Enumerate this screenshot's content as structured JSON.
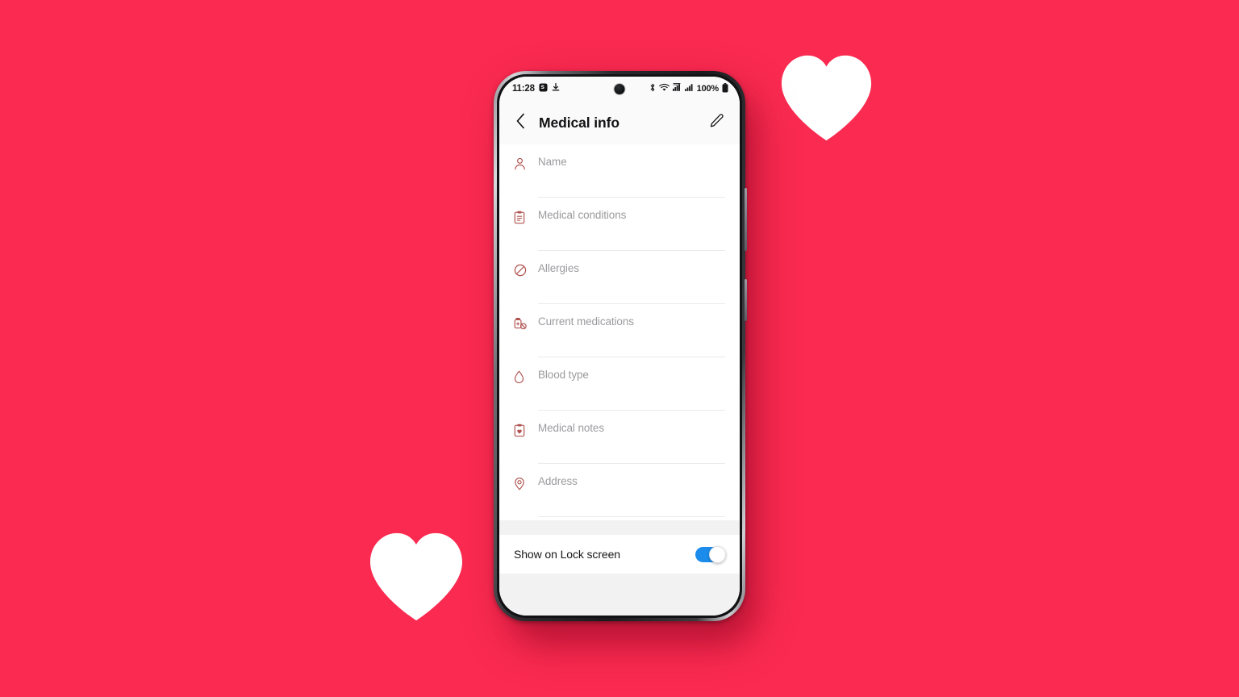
{
  "background": {
    "color": "#fa2a50",
    "decorations": [
      {
        "name": "heart-top-right",
        "shape": "heart",
        "color": "#ffffff"
      },
      {
        "name": "heart-bottom-left",
        "shape": "heart",
        "color": "#ffffff"
      }
    ]
  },
  "device": {
    "frame_color": "#1b1b1e",
    "buttons": [
      "volume-button",
      "power-button"
    ]
  },
  "status_bar": {
    "clock": "11:28",
    "left_icons": [
      "samsung-notification-icon",
      "download-icon"
    ],
    "right_icons": [
      "bluetooth-icon",
      "wifi-icon",
      "mobile-data-icon",
      "signal-bars-icon"
    ],
    "battery": "100%",
    "battery_icon": "battery-full-icon"
  },
  "header": {
    "back_icon": "chevron-left-icon",
    "title": "Medical info",
    "edit_icon": "pencil-edit-icon"
  },
  "accent": {
    "icon_color": "#b0534f",
    "toggle_on_color": "#1b8ceb",
    "label_color": "#9b9b9f"
  },
  "fields": [
    {
      "icon": "person-icon",
      "label": "Name",
      "value": "",
      "placeholder": "Name"
    },
    {
      "icon": "clipboard-icon",
      "label": "Medical conditions",
      "value": "",
      "placeholder": "Medical conditions"
    },
    {
      "icon": "no-entry-icon",
      "label": "Allergies",
      "value": "",
      "placeholder": "Allergies"
    },
    {
      "icon": "pill-bottle-icon",
      "label": "Current medications",
      "value": "",
      "placeholder": "Current medications"
    },
    {
      "icon": "blood-drop-icon",
      "label": "Blood type",
      "value": "",
      "placeholder": "Blood type"
    },
    {
      "icon": "medical-notes-icon",
      "label": "Medical notes",
      "value": "",
      "placeholder": "Medical notes"
    },
    {
      "icon": "location-pin-icon",
      "label": "Address",
      "value": "",
      "placeholder": "Address"
    }
  ],
  "lock_screen_setting": {
    "label": "Show on Lock screen",
    "enabled": true,
    "state_text": "On"
  }
}
